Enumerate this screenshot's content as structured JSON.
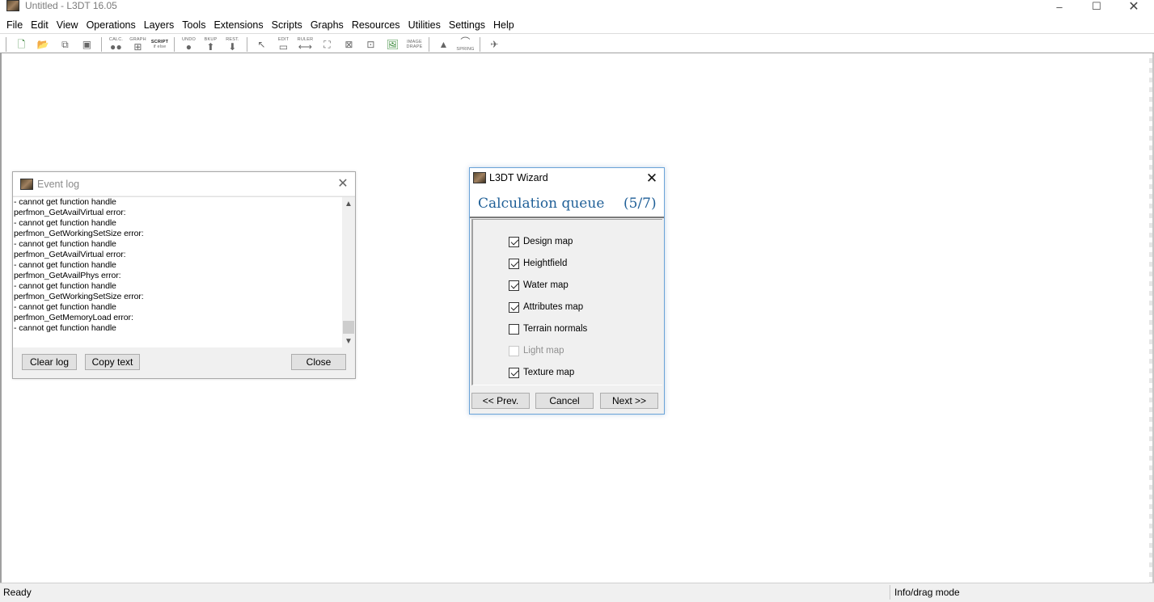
{
  "window": {
    "title": "Untitled - L3DT 16.05",
    "min_icon": "–",
    "max_icon": "☐",
    "close_icon": "✕"
  },
  "menu": [
    "File",
    "Edit",
    "View",
    "Operations",
    "Layers",
    "Tools",
    "Extensions",
    "Scripts",
    "Graphs",
    "Resources",
    "Utilities",
    "Settings",
    "Help"
  ],
  "toolbar": {
    "calc": "CALC.",
    "graph": "GRAPH",
    "script": "SCRIPT",
    "script_sub": "if else",
    "undo": "UNDO",
    "bkup": "BKUP",
    "rest": "REST.",
    "edit": "EDIT",
    "ruler": "RULER",
    "image": "IMAGE",
    "drape": "DRAPE",
    "spring": "SPRING"
  },
  "event_log": {
    "title": "Event log",
    "close_icon": "✕",
    "lines": [
      " - cannot get function handle",
      "perfmon_GetAvailVirtual error:",
      " - cannot get function handle",
      "perfmon_GetWorkingSetSize error:",
      " - cannot get function handle",
      "perfmon_GetAvailVirtual error:",
      " - cannot get function handle",
      "perfmon_GetAvailPhys error:",
      " - cannot get function handle",
      "perfmon_GetWorkingSetSize error:",
      " - cannot get function handle",
      "perfmon_GetMemoryLoad error:",
      " - cannot get function handle"
    ],
    "scroll_up": "▲",
    "scroll_down": "▼",
    "buttons": {
      "clear": "Clear log",
      "copy": "Copy text",
      "close": "Close"
    }
  },
  "wizard": {
    "title": "L3DT Wizard",
    "close_icon": "✕",
    "heading": "Calculation queue",
    "step": "(5/7)",
    "items": [
      {
        "label": "Design map",
        "checked": true,
        "enabled": true
      },
      {
        "label": "Heightfield",
        "checked": true,
        "enabled": true
      },
      {
        "label": "Water map",
        "checked": true,
        "enabled": true
      },
      {
        "label": "Attributes map",
        "checked": true,
        "enabled": true
      },
      {
        "label": "Terrain normals",
        "checked": false,
        "enabled": true
      },
      {
        "label": "Light map",
        "checked": false,
        "enabled": false
      },
      {
        "label": "Texture map",
        "checked": true,
        "enabled": true
      }
    ],
    "buttons": {
      "prev": "<< Prev.",
      "cancel": "Cancel",
      "next": "Next >>"
    }
  },
  "status": {
    "left": "Ready",
    "right": "Info/drag mode"
  }
}
